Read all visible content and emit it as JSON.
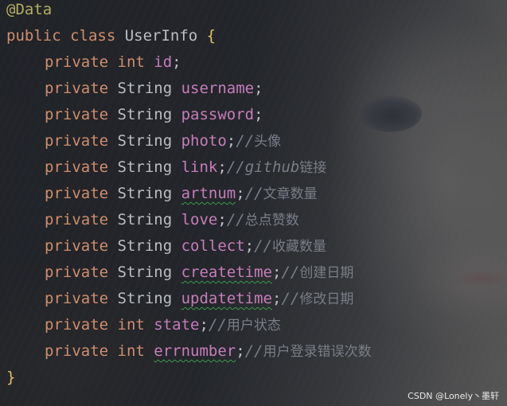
{
  "editor": {
    "lines": [
      {
        "id": "l1",
        "tokens": [
          {
            "t": "@Data",
            "c": "ann"
          }
        ]
      },
      {
        "id": "l2",
        "tokens": [
          {
            "t": "public ",
            "c": "kw"
          },
          {
            "t": "class ",
            "c": "kw"
          },
          {
            "t": "UserInfo ",
            "c": "cls"
          },
          {
            "t": "{",
            "c": "brace"
          }
        ]
      },
      {
        "id": "l3",
        "tokens": [
          {
            "t": "private ",
            "c": "kw"
          },
          {
            "t": "int ",
            "c": "kw"
          },
          {
            "t": "id",
            "c": "fld"
          },
          {
            "t": ";",
            "c": "punc"
          }
        ]
      },
      {
        "id": "l4",
        "tokens": [
          {
            "t": "private ",
            "c": "kw"
          },
          {
            "t": "String ",
            "c": "cls"
          },
          {
            "t": "username",
            "c": "fld"
          },
          {
            "t": ";",
            "c": "punc"
          }
        ]
      },
      {
        "id": "l5",
        "tokens": [
          {
            "t": "private ",
            "c": "kw"
          },
          {
            "t": "String ",
            "c": "cls"
          },
          {
            "t": "password",
            "c": "fld"
          },
          {
            "t": ";",
            "c": "punc"
          }
        ]
      },
      {
        "id": "l6",
        "tokens": [
          {
            "t": "private ",
            "c": "kw"
          },
          {
            "t": "String ",
            "c": "cls"
          },
          {
            "t": "photo",
            "c": "fld"
          },
          {
            "t": ";",
            "c": "punc"
          },
          {
            "t": "//",
            "c": "cmt"
          },
          {
            "t": "头像",
            "c": "cmt-cn"
          }
        ]
      },
      {
        "id": "l7",
        "tokens": [
          {
            "t": "private ",
            "c": "kw"
          },
          {
            "t": "String ",
            "c": "cls"
          },
          {
            "t": "link",
            "c": "fld"
          },
          {
            "t": ";",
            "c": "punc"
          },
          {
            "t": "//github",
            "c": "cmt"
          },
          {
            "t": "链接",
            "c": "cmt-cn"
          }
        ]
      },
      {
        "id": "l8",
        "tokens": [
          {
            "t": "private ",
            "c": "kw"
          },
          {
            "t": "String ",
            "c": "cls"
          },
          {
            "t": "artnum",
            "c": "fld squiggle"
          },
          {
            "t": ";",
            "c": "punc"
          },
          {
            "t": "//",
            "c": "cmt"
          },
          {
            "t": "文章数量",
            "c": "cmt-cn"
          }
        ]
      },
      {
        "id": "l9",
        "tokens": [
          {
            "t": "private ",
            "c": "kw"
          },
          {
            "t": "String ",
            "c": "cls"
          },
          {
            "t": "love",
            "c": "fld"
          },
          {
            "t": ";",
            "c": "punc"
          },
          {
            "t": "//",
            "c": "cmt"
          },
          {
            "t": "总点赞数",
            "c": "cmt-cn"
          }
        ]
      },
      {
        "id": "l10",
        "tokens": [
          {
            "t": "private ",
            "c": "kw"
          },
          {
            "t": "String ",
            "c": "cls"
          },
          {
            "t": "collect",
            "c": "fld"
          },
          {
            "t": ";",
            "c": "punc"
          },
          {
            "t": "//",
            "c": "cmt"
          },
          {
            "t": "收藏数量",
            "c": "cmt-cn"
          }
        ]
      },
      {
        "id": "l11",
        "tokens": [
          {
            "t": "private ",
            "c": "kw"
          },
          {
            "t": "String ",
            "c": "cls"
          },
          {
            "t": "createtime",
            "c": "fld squiggle"
          },
          {
            "t": ";",
            "c": "punc"
          },
          {
            "t": "//",
            "c": "cmt"
          },
          {
            "t": "创建日期",
            "c": "cmt-cn"
          }
        ]
      },
      {
        "id": "l12",
        "tokens": [
          {
            "t": "private ",
            "c": "kw"
          },
          {
            "t": "String ",
            "c": "cls"
          },
          {
            "t": "updatetime",
            "c": "fld squiggle"
          },
          {
            "t": ";",
            "c": "punc"
          },
          {
            "t": "//",
            "c": "cmt"
          },
          {
            "t": "修改日期",
            "c": "cmt-cn"
          }
        ]
      },
      {
        "id": "l13",
        "tokens": [
          {
            "t": "private ",
            "c": "kw"
          },
          {
            "t": "int ",
            "c": "kw"
          },
          {
            "t": "state",
            "c": "fld"
          },
          {
            "t": ";",
            "c": "punc"
          },
          {
            "t": "//",
            "c": "cmt"
          },
          {
            "t": "用户状态",
            "c": "cmt-cn"
          }
        ]
      },
      {
        "id": "l14",
        "tokens": [
          {
            "t": "private ",
            "c": "kw"
          },
          {
            "t": "int ",
            "c": "kw"
          },
          {
            "t": "errnumber",
            "c": "fld squiggle"
          },
          {
            "t": ";",
            "c": "punc"
          },
          {
            "t": "//",
            "c": "cmt"
          },
          {
            "t": "用户登录错误次数",
            "c": "cmt-cn"
          }
        ]
      },
      {
        "id": "l15",
        "tokens": [
          {
            "t": "}",
            "c": "brace"
          }
        ]
      }
    ]
  },
  "watermark": "CSDN @Lonely丶墨轩",
  "colors": {
    "keyword": "#cf8e6d",
    "annotation": "#b3ae60",
    "field": "#c77dbb",
    "comment": "#7a7e85",
    "text": "#bcbec4",
    "brace": "#e8bf6a"
  }
}
